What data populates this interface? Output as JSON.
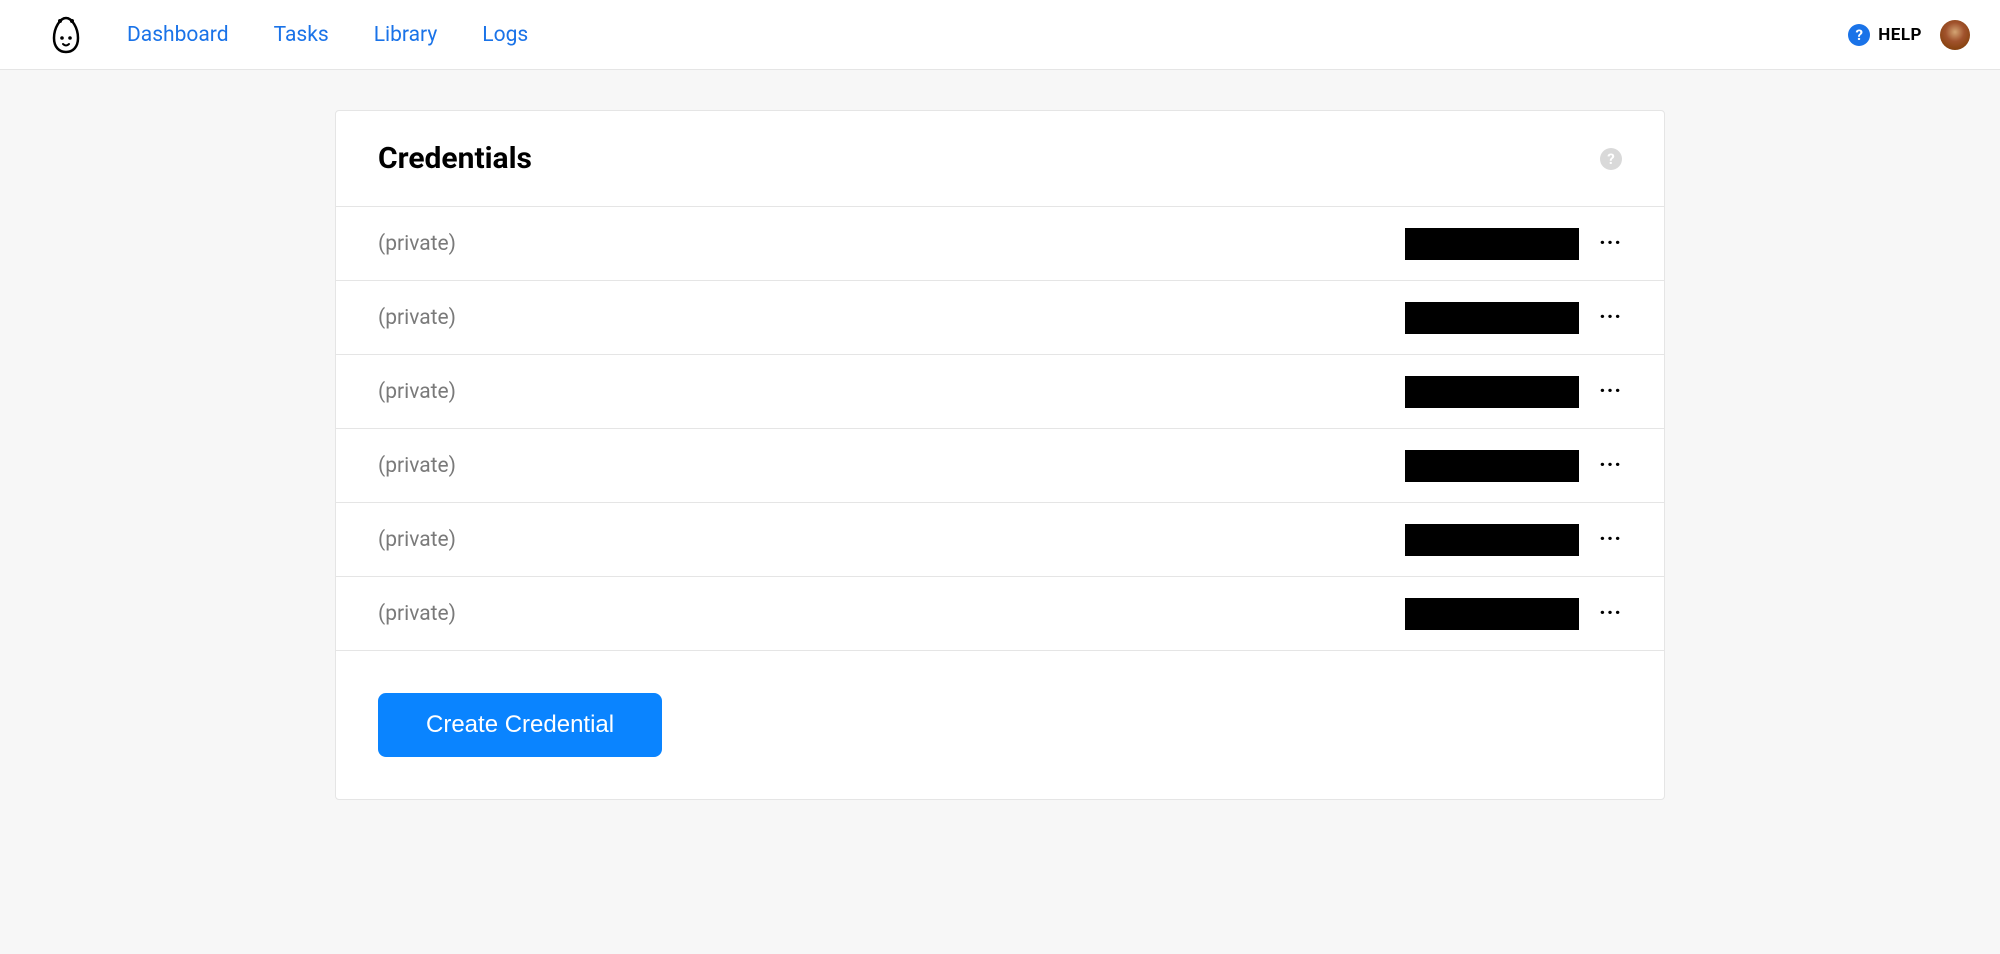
{
  "nav": {
    "links": [
      "Dashboard",
      "Tasks",
      "Library",
      "Logs"
    ]
  },
  "header": {
    "help_label": "HELP"
  },
  "card": {
    "title": "Credentials",
    "create_button": "Create Credential"
  },
  "credentials": [
    {
      "name": "(private)"
    },
    {
      "name": "(private)"
    },
    {
      "name": "(private)"
    },
    {
      "name": "(private)"
    },
    {
      "name": "(private)"
    },
    {
      "name": "(private)"
    }
  ]
}
